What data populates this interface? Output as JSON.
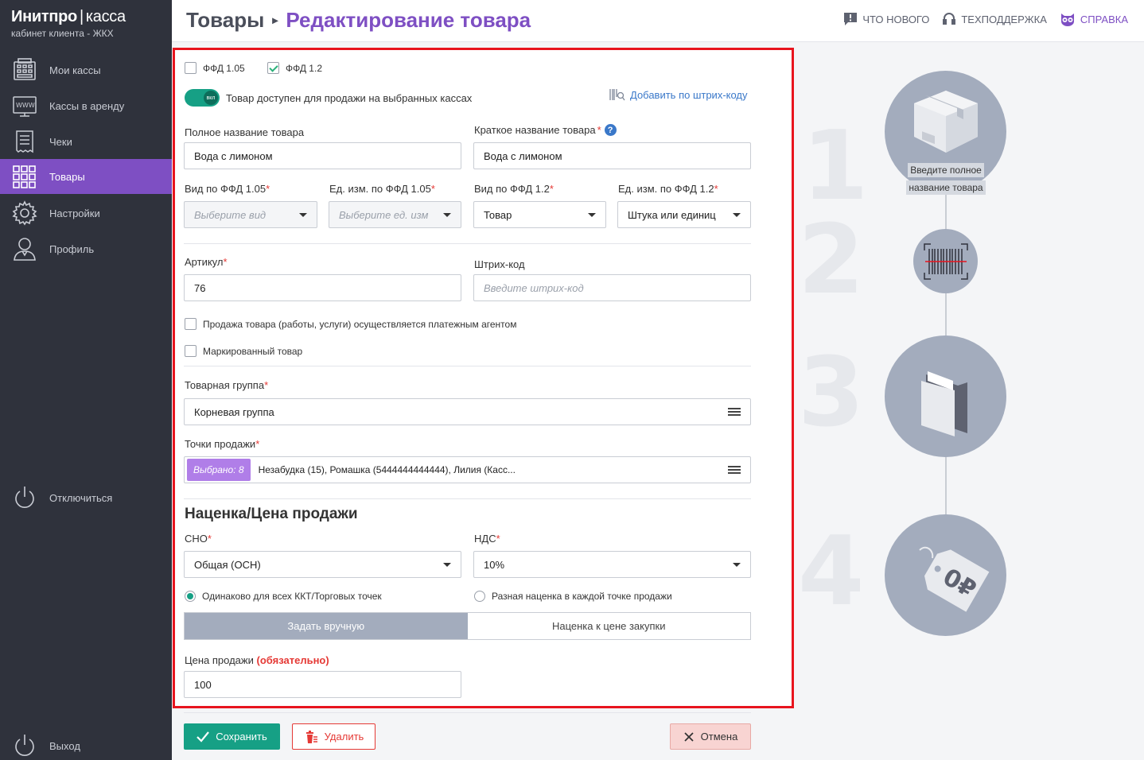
{
  "brand": {
    "name": "Инитпро",
    "separator": "|",
    "product": "касса",
    "subtitle": "кабинет клиента - ЖКХ"
  },
  "sidebar": {
    "items": [
      {
        "label": "Мои кассы",
        "icon": "register-icon"
      },
      {
        "label": "Кассы в аренду",
        "icon": "www-icon"
      },
      {
        "label": "Чеки",
        "icon": "receipt-icon"
      },
      {
        "label": "Товары",
        "icon": "grid-icon",
        "active": true
      },
      {
        "label": "Настройки",
        "icon": "gear-icon"
      },
      {
        "label": "Профиль",
        "icon": "user-icon"
      }
    ],
    "disconnect_label": "Отключиться",
    "logout_label": "Выход"
  },
  "header": {
    "crumb1": "Товары",
    "crumb2": "Редактирование товара",
    "links": {
      "news": "ЧТО НОВОГО",
      "support": "ТЕХПОДДЕРЖКА",
      "help": "СПРАВКА"
    }
  },
  "form": {
    "ffd105": "ФФД 1.05",
    "ffd12": "ФФД 1.2",
    "available_label": "Товар доступен для продажи на выбранных кассах",
    "toggle_text": "вкл",
    "barcode_link": "Добавить по штрих-коду",
    "full_name_label": "Полное название товара",
    "full_name_value": "Вода с лимоном",
    "short_name_label": "Краткое название товара",
    "short_name_value": "Вода с лимоном",
    "help_mark": "?",
    "kind105_label": "Вид по ФФД 1.05",
    "kind105_placeholder": "Выберите вид",
    "unit105_label": "Ед. изм. по ФФД 1.05",
    "unit105_placeholder": "Выберите ед. изм",
    "kind12_label": "Вид по ФФД 1.2",
    "kind12_value": "Товар",
    "unit12_label": "Ед. изм. по ФФД 1.2",
    "unit12_value": "Штука или единиц",
    "sku_label": "Артикул",
    "sku_value": "76",
    "barcode_label": "Штрих-код",
    "barcode_placeholder": "Введите штрих-код",
    "agent_label": "Продажа товара (работы, услуги) осуществляется платежным агентом",
    "marked_label": "Маркированный товар",
    "group_label": "Товарная группа",
    "group_value": "Корневая группа",
    "points_label": "Точки продажи",
    "points_badge": "Выбрано: 8",
    "points_value": "Незабудка (15), Ромашка (5444444444444), Лилия (Касс...",
    "section_title": "Наценка/Цена продажи",
    "sno_label": "СНО",
    "sno_value": "Общая (ОСН)",
    "vat_label": "НДС",
    "vat_value": "10%",
    "radio_same": "Одинаково для всех ККТ/Торговых точек",
    "radio_diff": "Разная наценка в каждой точке продажи",
    "seg_manual": "Задать вручную",
    "seg_markup": "Наценка к цене закупки",
    "price_label": "Цена продажи",
    "price_required": "(обязательно)",
    "price_value": "100",
    "required_mark": "*"
  },
  "buttons": {
    "save": "Сохранить",
    "delete": "Удалить",
    "cancel": "Отмена"
  },
  "steps": {
    "numbers": [
      "1",
      "2",
      "3",
      "4"
    ],
    "caption_line1": "Введите полное",
    "caption_line2": "название товара",
    "price_tag_text": "0₽"
  },
  "colors": {
    "accent": "#7e4fc3",
    "success": "#16a085",
    "danger": "#e53935",
    "sidebar": "#2f323c",
    "frame": "#e8141e"
  }
}
